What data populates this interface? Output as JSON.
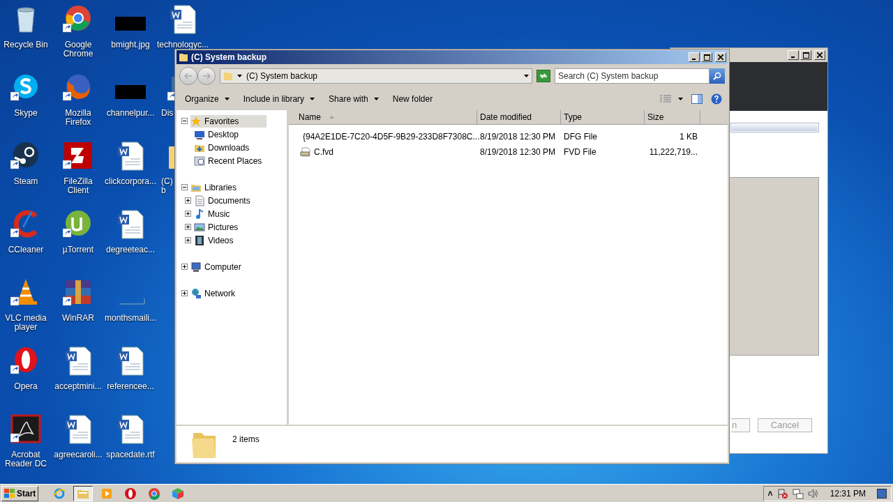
{
  "desktop": {
    "icons": [
      {
        "label": "Recycle Bin",
        "kind": "trash",
        "shortcut": false
      },
      {
        "label": "Google Chrome",
        "kind": "chrome",
        "shortcut": true
      },
      {
        "label": "bmight.jpg",
        "kind": "black",
        "shortcut": false
      },
      {
        "label": "technologyc...",
        "kind": "word",
        "shortcut": false
      },
      {
        "label": "Skype",
        "kind": "skype",
        "shortcut": true
      },
      {
        "label": "Mozilla Firefox",
        "kind": "firefox",
        "shortcut": true
      },
      {
        "label": "channelpur...",
        "kind": "black",
        "shortcut": false
      },
      {
        "label": "Dis",
        "kind": "app",
        "shortcut": true
      },
      {
        "label": "Steam",
        "kind": "steam",
        "shortcut": true
      },
      {
        "label": "FileZilla Client",
        "kind": "filezilla",
        "shortcut": true
      },
      {
        "label": "clickcorpora...",
        "kind": "word",
        "shortcut": false
      },
      {
        "label": "(C) b",
        "kind": "folder",
        "shortcut": false
      },
      {
        "label": "CCleaner",
        "kind": "ccleaner",
        "shortcut": true
      },
      {
        "label": "µTorrent",
        "kind": "utorrent",
        "shortcut": true
      },
      {
        "label": "degreeteac...",
        "kind": "word",
        "shortcut": false
      },
      {
        "label": "VLC media player",
        "kind": "vlc",
        "shortcut": true
      },
      {
        "label": "WinRAR",
        "kind": "winrar",
        "shortcut": true
      },
      {
        "label": "monthsmaili...",
        "kind": "blank",
        "shortcut": false
      },
      {
        "label": "Opera",
        "kind": "opera",
        "shortcut": true
      },
      {
        "label": "acceptmini...",
        "kind": "word",
        "shortcut": false
      },
      {
        "label": "referencee...",
        "kind": "word",
        "shortcut": false
      },
      {
        "label": "Acrobat Reader DC",
        "kind": "acrobat",
        "shortcut": true
      },
      {
        "label": "agreecaroli...",
        "kind": "word",
        "shortcut": false
      },
      {
        "label": "spacedate.rtf",
        "kind": "word",
        "shortcut": false
      }
    ]
  },
  "back_window": {
    "progress": {
      "level": 1
    },
    "buttons": [
      "n",
      "Cancel"
    ]
  },
  "window": {
    "title": "(C) System backup",
    "address": "(C) System backup",
    "search": {
      "placeholder": "Search (C) System backup"
    },
    "toolbar": [
      {
        "label": "Organize",
        "dropdown": true
      },
      {
        "label": "Include in library",
        "dropdown": true
      },
      {
        "label": "Share with",
        "dropdown": true
      },
      {
        "label": "New folder",
        "dropdown": false
      }
    ],
    "nav": [
      {
        "label": "Favorites",
        "kind": "star",
        "expanded": true,
        "selected": true,
        "children": [
          {
            "label": "Desktop",
            "kind": "desktop",
            "selected": false
          },
          {
            "label": "Downloads",
            "kind": "downloads",
            "selected": false
          },
          {
            "label": "Recent Places",
            "kind": "recent",
            "selected": false
          }
        ]
      },
      {
        "label": "Libraries",
        "kind": "library",
        "expanded": true,
        "selected": false,
        "children": [
          {
            "label": "Documents",
            "kind": "documents",
            "expanded": false,
            "selected": false
          },
          {
            "label": "Music",
            "kind": "music",
            "expanded": false,
            "selected": false
          },
          {
            "label": "Pictures",
            "kind": "pictures",
            "expanded": false,
            "selected": false
          },
          {
            "label": "Videos",
            "kind": "videos",
            "expanded": false,
            "selected": false
          }
        ]
      },
      {
        "label": "Computer",
        "kind": "computer",
        "expanded": false,
        "selected": false
      },
      {
        "label": "Network",
        "kind": "network",
        "expanded": false,
        "selected": false
      }
    ],
    "table": {
      "columns": [
        {
          "label": "Name",
          "sorted": true
        },
        {
          "label": "Date modified",
          "sorted": false
        },
        {
          "label": "Type",
          "sorted": false
        },
        {
          "label": "Size",
          "sorted": false
        }
      ],
      "rows": [
        {
          "name": "{94A2E1DE-7C20-4D5F-9B29-233D8F7308C...",
          "date": "8/19/2018 12:30 PM",
          "type": "DFG File",
          "size": "1 KB",
          "kind": "file"
        },
        {
          "name": "C.fvd",
          "date": "8/19/2018 12:30 PM",
          "type": "FVD File",
          "size": "11,222,719...",
          "kind": "disk"
        }
      ]
    },
    "status": "2 items"
  },
  "taskbar": {
    "start": "Start",
    "apps": [
      {
        "kind": "ie",
        "active": false
      },
      {
        "kind": "explorer",
        "active": true
      },
      {
        "kind": "media",
        "active": false
      },
      {
        "kind": "opera",
        "active": false
      },
      {
        "kind": "chrome",
        "active": false
      },
      {
        "kind": "box",
        "active": false
      }
    ],
    "tray_arrow": "˄",
    "time": "12:31 PM"
  }
}
